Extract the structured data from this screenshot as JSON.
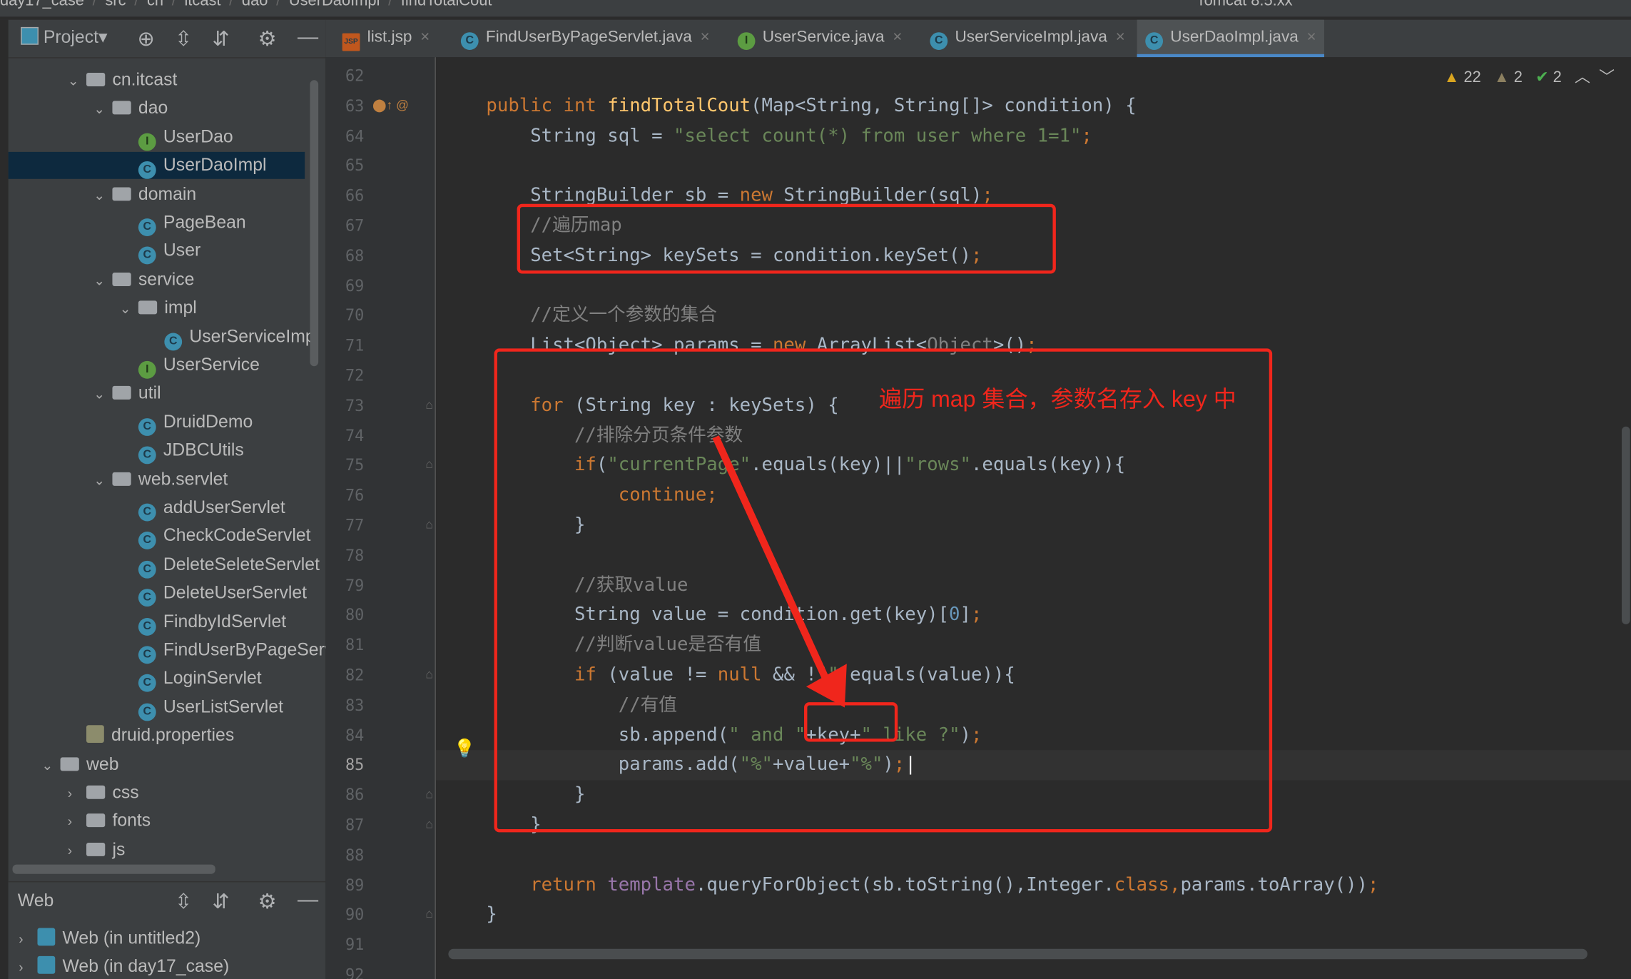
{
  "breadcrumb": [
    "day17_case",
    "src",
    "cn",
    "itcast",
    "dao",
    "UserDaoImpl",
    "findTotalCout"
  ],
  "run_config": "Tomcat 8.5.xx",
  "project_panel": {
    "title": "Project",
    "items": [
      {
        "label": "cn.itcast",
        "depth": 1,
        "type": "folder",
        "open": true
      },
      {
        "label": "dao",
        "depth": 2,
        "type": "folder",
        "open": true
      },
      {
        "label": "UserDao",
        "depth": 3,
        "type": "interface"
      },
      {
        "label": "UserDaoImpl",
        "depth": 3,
        "type": "class",
        "selected": true
      },
      {
        "label": "domain",
        "depth": 2,
        "type": "folder",
        "open": true
      },
      {
        "label": "PageBean",
        "depth": 3,
        "type": "class"
      },
      {
        "label": "User",
        "depth": 3,
        "type": "class"
      },
      {
        "label": "service",
        "depth": 2,
        "type": "folder",
        "open": true
      },
      {
        "label": "impl",
        "depth": 3,
        "type": "folder",
        "open": true
      },
      {
        "label": "UserServiceImpl",
        "depth": 4,
        "type": "class"
      },
      {
        "label": "UserService",
        "depth": 3,
        "type": "interface"
      },
      {
        "label": "util",
        "depth": 2,
        "type": "folder",
        "open": true
      },
      {
        "label": "DruidDemo",
        "depth": 3,
        "type": "class"
      },
      {
        "label": "JDBCUtils",
        "depth": 3,
        "type": "class"
      },
      {
        "label": "web.servlet",
        "depth": 2,
        "type": "folder",
        "open": true
      },
      {
        "label": "addUserServlet",
        "depth": 3,
        "type": "class"
      },
      {
        "label": "CheckCodeServlet",
        "depth": 3,
        "type": "class"
      },
      {
        "label": "DeleteSeleteServlet",
        "depth": 3,
        "type": "class"
      },
      {
        "label": "DeleteUserServlet",
        "depth": 3,
        "type": "class"
      },
      {
        "label": "FindbyIdServlet",
        "depth": 3,
        "type": "class"
      },
      {
        "label": "FindUserByPageServlet",
        "depth": 3,
        "type": "class"
      },
      {
        "label": "LoginServlet",
        "depth": 3,
        "type": "class"
      },
      {
        "label": "UserListServlet",
        "depth": 3,
        "type": "class"
      },
      {
        "label": "druid.properties",
        "depth": 1,
        "type": "props"
      },
      {
        "label": "web",
        "depth": 0,
        "type": "folder",
        "open": true
      },
      {
        "label": "css",
        "depth": 1,
        "type": "folder",
        "open": false
      },
      {
        "label": "fonts",
        "depth": 1,
        "type": "folder",
        "open": false
      },
      {
        "label": "js",
        "depth": 1,
        "type": "folder",
        "open": false
      }
    ]
  },
  "web_panel": {
    "title": "Web",
    "items": [
      "Web (in untitled2)",
      "Web (in day17_case)"
    ]
  },
  "tabs": [
    {
      "label": "list.jsp",
      "icon": "jsp"
    },
    {
      "label": "FindUserByPageServlet.java",
      "icon": "class"
    },
    {
      "label": "UserService.java",
      "icon": "interface"
    },
    {
      "label": "UserServiceImpl.java",
      "icon": "class"
    },
    {
      "label": "UserDaoImpl.java",
      "icon": "class",
      "active": true
    }
  ],
  "inspections": {
    "warnings": "22",
    "weak_warnings": "2",
    "typos": "2"
  },
  "current_line": 85,
  "code": [
    {
      "n": 62,
      "t": []
    },
    {
      "n": 63,
      "t": [
        [
          "p",
          "    "
        ],
        [
          "k",
          "public int "
        ],
        [
          "m",
          "findTotalCout"
        ],
        [
          "p",
          "(Map<String, String[]> condition) {"
        ]
      ]
    },
    {
      "n": 64,
      "t": [
        [
          "p",
          "        String sql = "
        ],
        [
          "s",
          "\"select count(*) from user where 1=1\""
        ],
        [
          "k",
          ";"
        ]
      ]
    },
    {
      "n": 65,
      "t": []
    },
    {
      "n": 66,
      "t": [
        [
          "p",
          "        StringBuilder sb = "
        ],
        [
          "k",
          "new "
        ],
        [
          "p",
          "StringBuilder(sql)"
        ],
        [
          "k",
          ";"
        ]
      ]
    },
    {
      "n": 67,
      "t": [
        [
          "c",
          "        //遍历map"
        ]
      ]
    },
    {
      "n": 68,
      "t": [
        [
          "p",
          "        Set<String> keySets = condition.keySet()"
        ],
        [
          "k",
          ";"
        ]
      ]
    },
    {
      "n": 69,
      "t": []
    },
    {
      "n": 70,
      "t": [
        [
          "c",
          "        //定义一个参数的集合"
        ]
      ]
    },
    {
      "n": 71,
      "t": [
        [
          "p",
          "        List<Object> params = "
        ],
        [
          "k",
          "new "
        ],
        [
          "p",
          "ArrayList<"
        ],
        [
          "c",
          "Object"
        ],
        [
          "p",
          ">()"
        ],
        [
          "k",
          ";"
        ]
      ]
    },
    {
      "n": 72,
      "t": []
    },
    {
      "n": 73,
      "t": [
        [
          "p",
          "        "
        ],
        [
          "k",
          "for "
        ],
        [
          "p",
          "(String key : keySets) {"
        ]
      ]
    },
    {
      "n": 74,
      "t": [
        [
          "c",
          "            //排除分页条件参数"
        ]
      ]
    },
    {
      "n": 75,
      "t": [
        [
          "p",
          "            "
        ],
        [
          "k",
          "if"
        ],
        [
          "p",
          "("
        ],
        [
          "s",
          "\"currentPage\""
        ],
        [
          "p",
          ".equals(key)||"
        ],
        [
          "s",
          "\"rows\""
        ],
        [
          "p",
          ".equals(key)){"
        ]
      ]
    },
    {
      "n": 76,
      "t": [
        [
          "k",
          "                continue;"
        ]
      ]
    },
    {
      "n": 77,
      "t": [
        [
          "p",
          "            }"
        ]
      ]
    },
    {
      "n": 78,
      "t": []
    },
    {
      "n": 79,
      "t": [
        [
          "c",
          "            //获取value"
        ]
      ]
    },
    {
      "n": 80,
      "t": [
        [
          "p",
          "            String value = condition.get(key)["
        ],
        [
          "n",
          "0"
        ],
        [
          "p",
          "]"
        ],
        [
          "k",
          ";"
        ]
      ]
    },
    {
      "n": 81,
      "t": [
        [
          "c",
          "            //判断value是否有值"
        ]
      ]
    },
    {
      "n": 82,
      "t": [
        [
          "p",
          "            "
        ],
        [
          "k",
          "if "
        ],
        [
          "p",
          "(value != "
        ],
        [
          "k",
          "null "
        ],
        [
          "p",
          "&& !"
        ],
        [
          "s",
          "\"\""
        ],
        [
          "p",
          ".equals(value)){"
        ]
      ]
    },
    {
      "n": 83,
      "t": [
        [
          "c",
          "                //有值"
        ]
      ]
    },
    {
      "n": 84,
      "t": [
        [
          "p",
          "                sb.append("
        ],
        [
          "s",
          "\" and \""
        ],
        [
          "p",
          "+key+"
        ],
        [
          "s",
          "\" like ?\""
        ],
        [
          "p",
          ")"
        ],
        [
          "k",
          ";"
        ]
      ]
    },
    {
      "n": 85,
      "t": [
        [
          "p",
          "                params.add("
        ],
        [
          "s",
          "\"%\""
        ],
        [
          "p",
          "+value+"
        ],
        [
          "s",
          "\"%\""
        ],
        [
          "p",
          ")"
        ],
        [
          "k",
          ";"
        ]
      ]
    },
    {
      "n": 86,
      "t": [
        [
          "p",
          "            }"
        ]
      ]
    },
    {
      "n": 87,
      "t": [
        [
          "p",
          "        }"
        ]
      ]
    },
    {
      "n": 88,
      "t": []
    },
    {
      "n": 89,
      "t": [
        [
          "p",
          "        "
        ],
        [
          "k",
          "return "
        ],
        [
          "f",
          "template"
        ],
        [
          "p",
          ".queryForObject(sb.toString(),Integer."
        ],
        [
          "k",
          "class,"
        ],
        [
          "p",
          "params.toArray())"
        ],
        [
          "k",
          ";"
        ]
      ]
    },
    {
      "n": 90,
      "t": [
        [
          "p",
          "    }"
        ]
      ]
    },
    {
      "n": 91,
      "t": []
    },
    {
      "n": 92,
      "t": []
    }
  ],
  "annotation": "遍历 map 集合，参数名存入 key 中",
  "colors": {
    "annotation": "#f0261c",
    "keyword": "#cc7832",
    "string": "#6a8759",
    "comment": "#808080",
    "method": "#ffc66d"
  }
}
